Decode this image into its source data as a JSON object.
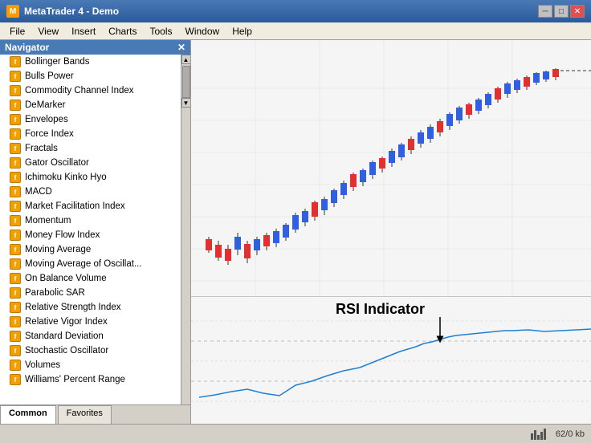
{
  "titlebar": {
    "title": "MetaTrader 4 - Demo",
    "icon": "MT4"
  },
  "menubar": {
    "items": [
      "File",
      "View",
      "Insert",
      "Charts",
      "Tools",
      "Window",
      "Help"
    ]
  },
  "navigator": {
    "title": "Navigator",
    "indicators": [
      "Bollinger Bands",
      "Bulls Power",
      "Commodity Channel Index",
      "DeMarker",
      "Envelopes",
      "Force Index",
      "Fractals",
      "Gator Oscillator",
      "Ichimoku Kinko Hyo",
      "MACD",
      "Market Facilitation Index",
      "Momentum",
      "Money Flow Index",
      "Moving Average",
      "Moving Average of Oscillat...",
      "On Balance Volume",
      "Parabolic SAR",
      "Relative Strength Index",
      "Relative Vigor Index",
      "Standard Deviation",
      "Stochastic Oscillator",
      "Volumes",
      "Williams' Percent Range"
    ],
    "tabs": [
      "Common",
      "Favorites"
    ]
  },
  "chart": {
    "rsi_label": "RSI Indicator"
  },
  "statusbar": {
    "size": "62/0 kb"
  }
}
